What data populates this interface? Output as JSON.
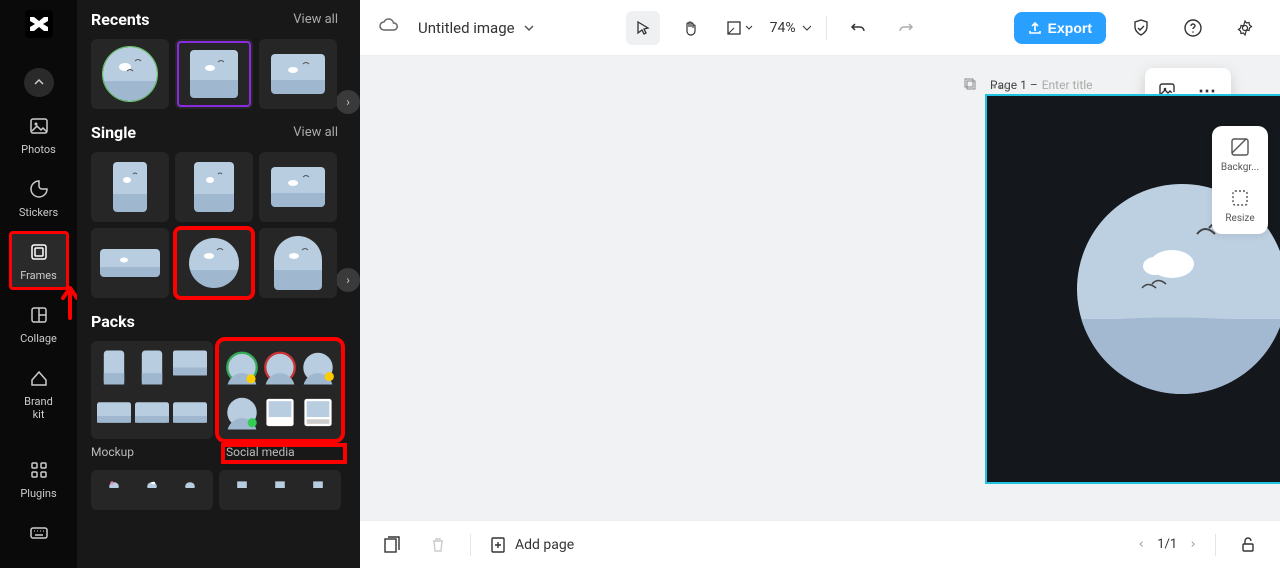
{
  "rail": {
    "photos": "Photos",
    "stickers": "Stickers",
    "frames": "Frames",
    "collage": "Collage",
    "brandkit": "Brand\nkit",
    "plugins": "Plugins"
  },
  "sidepanel": {
    "recents": {
      "title": "Recents",
      "viewall": "View all"
    },
    "single": {
      "title": "Single",
      "viewall": "View all"
    },
    "packs": {
      "title": "Packs"
    },
    "pack_labels": {
      "mockup": "Mockup",
      "social": "Social media"
    }
  },
  "topbar": {
    "title": "Untitled image",
    "zoom": "74%",
    "export": "Export"
  },
  "canvas": {
    "page_label": "Page 1 –",
    "title_placeholder": "Enter title"
  },
  "righttools": {
    "background": "Backgr...",
    "resize": "Resize"
  },
  "bottombar": {
    "addpage": "Add page",
    "pager": "1/1"
  }
}
